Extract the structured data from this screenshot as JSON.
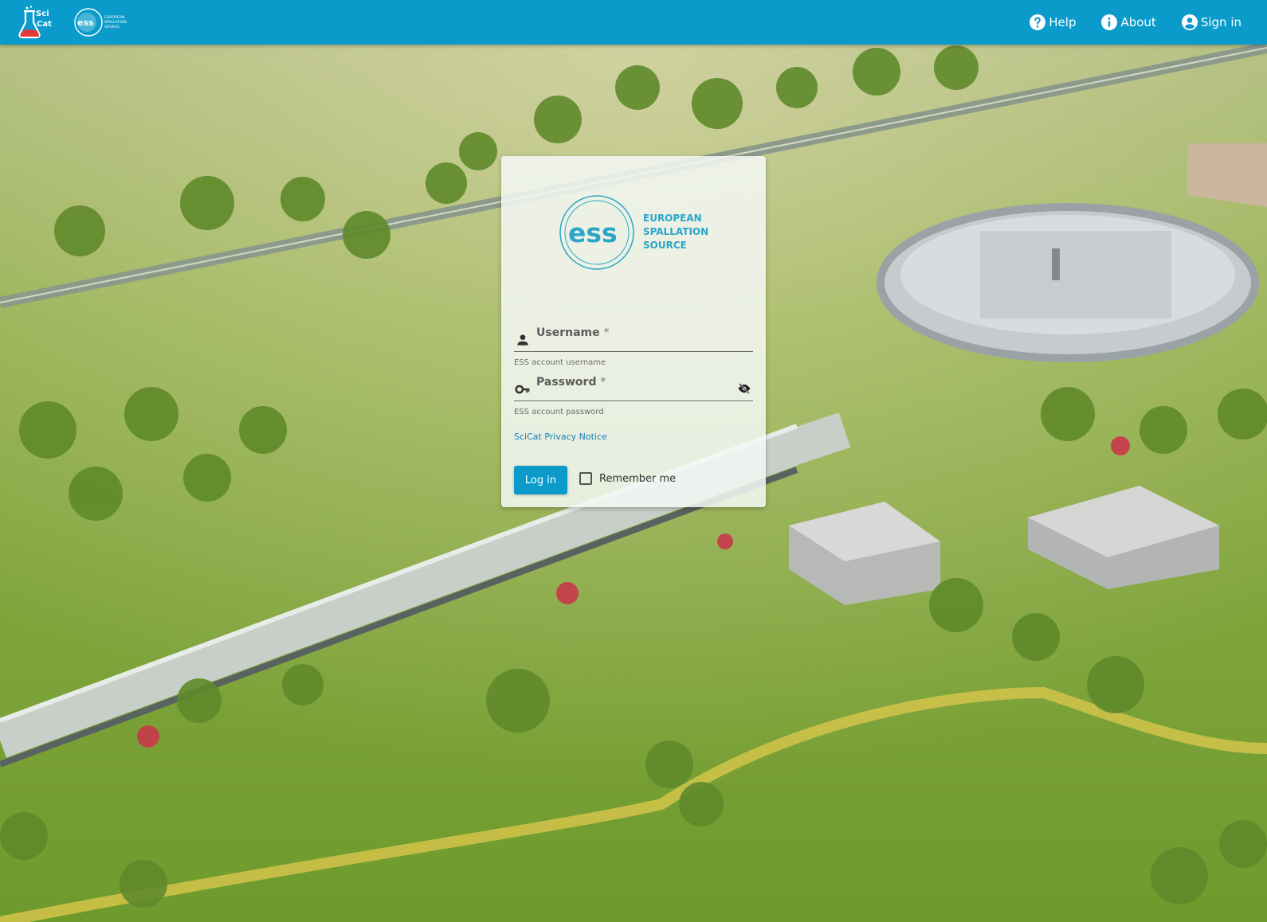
{
  "header": {
    "scicat_logo_text": "SciCat",
    "ess_logo_text": "ess",
    "ess_logo_lines": [
      "EUROPEAN",
      "SPALLATION",
      "SOURCE"
    ],
    "nav": [
      {
        "label": "Help",
        "icon": "help-circle-icon"
      },
      {
        "label": "About",
        "icon": "info-circle-icon"
      },
      {
        "label": "Sign in",
        "icon": "account-circle-icon"
      }
    ]
  },
  "login": {
    "logo_text": "ess",
    "logo_lines": [
      "EUROPEAN",
      "SPALLATION",
      "SOURCE"
    ],
    "username": {
      "label": "Username",
      "required_mark": "*",
      "value": "",
      "hint": "ESS account username",
      "icon": "person-icon"
    },
    "password": {
      "label": "Password",
      "required_mark": "*",
      "value": "",
      "hint": "ESS account password",
      "icon": "key-icon",
      "toggle_icon": "visibility-off-icon"
    },
    "privacy_link": "SciCat Privacy Notice",
    "login_button": "Log in",
    "remember_label": "Remember me",
    "remember_checked": false
  },
  "colors": {
    "primary": "#0a9bcb",
    "link": "#1480b5",
    "logo_teal": "#2aa6c8"
  }
}
